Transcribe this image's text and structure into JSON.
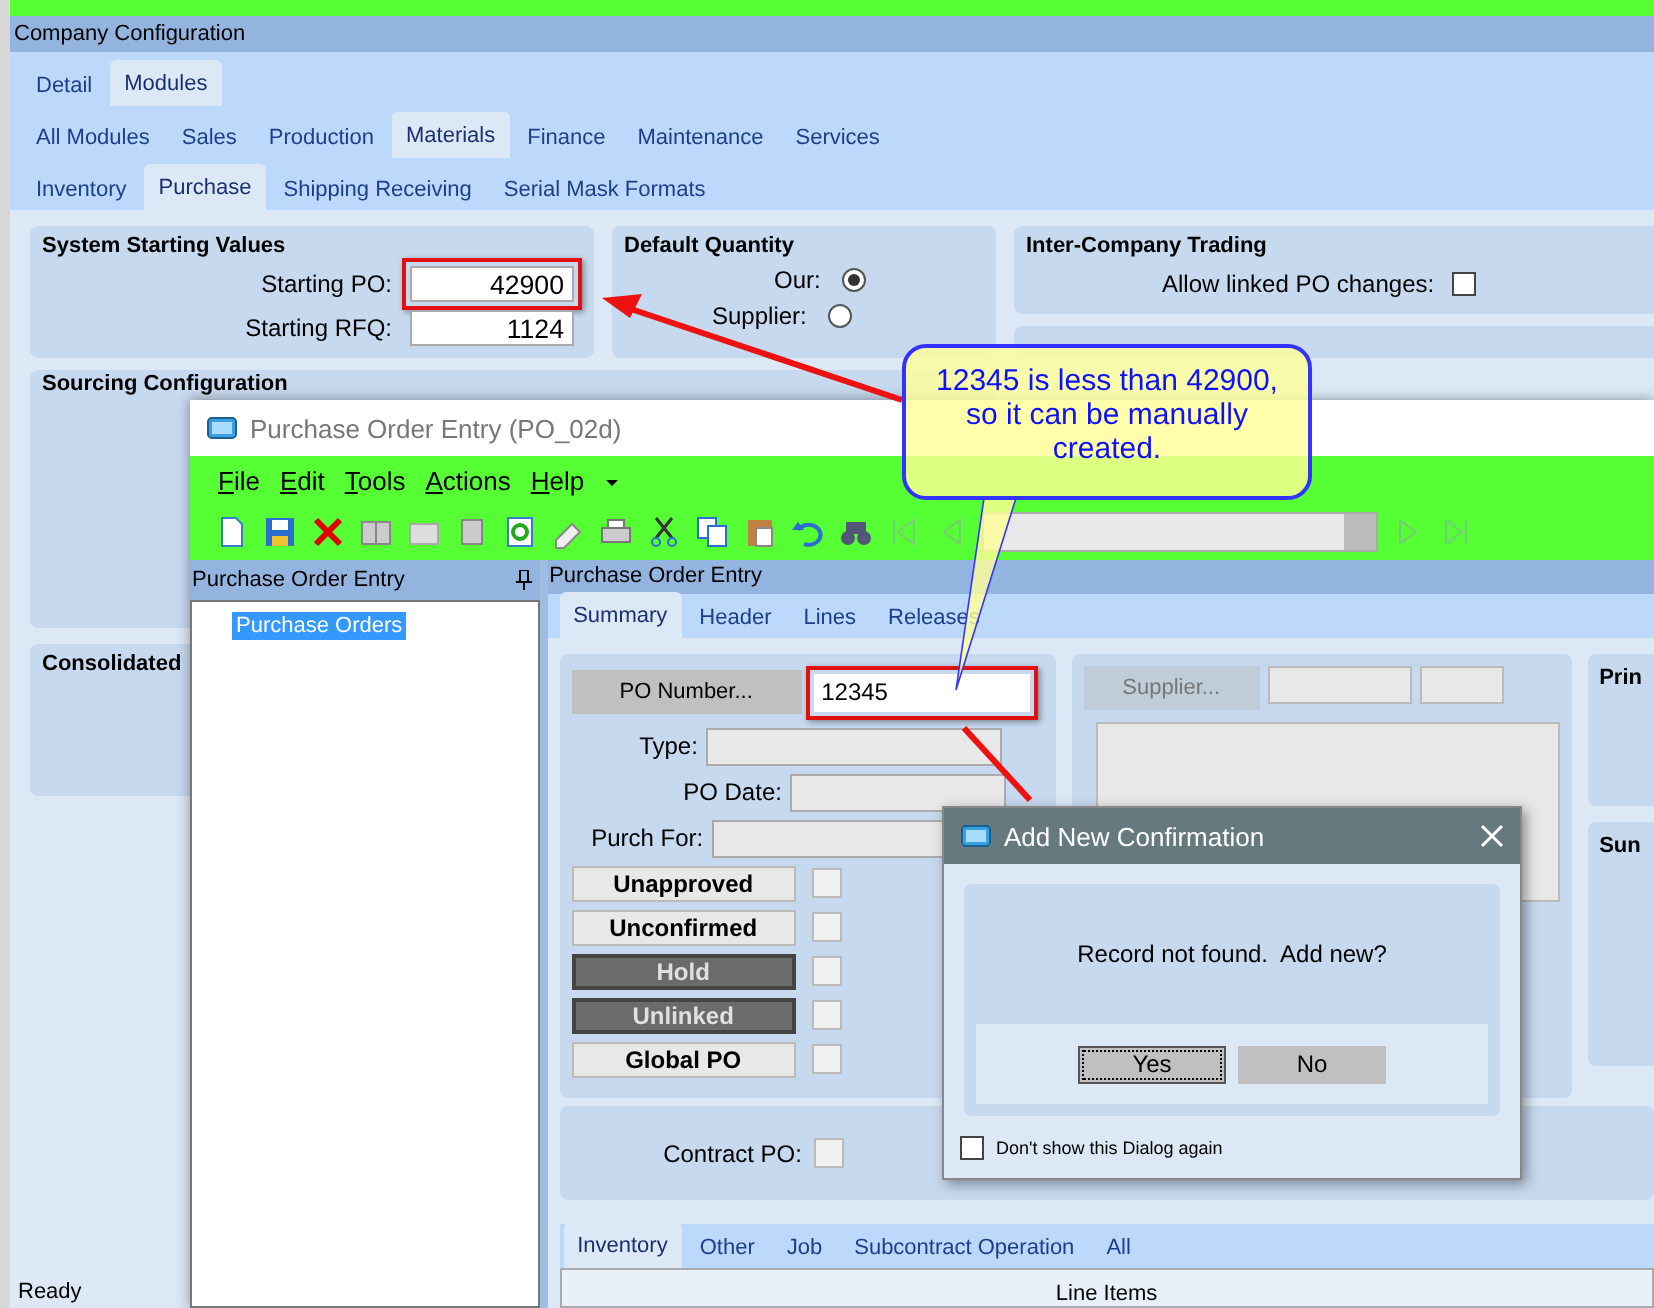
{
  "config_window": {
    "title": "Company Configuration",
    "tabs_1": [
      {
        "label": "Detail",
        "selected": false
      },
      {
        "label": "Modules",
        "selected": true
      }
    ],
    "tabs_2": [
      {
        "label": "All Modules",
        "selected": false
      },
      {
        "label": "Sales",
        "selected": false
      },
      {
        "label": "Production",
        "selected": false
      },
      {
        "label": "Materials",
        "selected": true
      },
      {
        "label": "Finance",
        "selected": false
      },
      {
        "label": "Maintenance",
        "selected": false
      },
      {
        "label": "Services",
        "selected": false
      }
    ],
    "tabs_3": [
      {
        "label": "Inventory",
        "selected": false
      },
      {
        "label": "Purchase",
        "selected": true
      },
      {
        "label": "Shipping Receiving",
        "selected": false
      },
      {
        "label": "Serial Mask Formats",
        "selected": false
      }
    ],
    "system_starting_values": {
      "title": "System Starting Values",
      "fields": [
        {
          "label": "Starting PO:",
          "value": "42900",
          "highlighted": true
        },
        {
          "label": "Starting RFQ:",
          "value": "1124",
          "highlighted": false
        }
      ]
    },
    "default_quantity": {
      "title": "Default Quantity",
      "options": [
        {
          "label": "Our:",
          "selected": true
        },
        {
          "label": "Supplier:",
          "selected": false
        }
      ]
    },
    "inter_company_trading": {
      "title": "Inter-Company Trading",
      "checkbox": {
        "label": "Allow linked PO changes:",
        "checked": false
      }
    },
    "sourcing_title": "Sourcing Configuration",
    "consolidated_title": "Consolidated",
    "status": "Ready"
  },
  "po_window": {
    "title": "Purchase Order Entry (PO_02d)",
    "menu": [
      "File",
      "Edit",
      "Tools",
      "Actions",
      "Help"
    ],
    "tree": {
      "header": "Purchase Order Entry",
      "items": [
        {
          "label": "Purchase Orders",
          "selected": true
        }
      ]
    },
    "detail_header": "Purchase Order Entry",
    "tabs": [
      {
        "label": "Summary",
        "selected": true
      },
      {
        "label": "Header",
        "selected": false
      },
      {
        "label": "Lines",
        "selected": false
      },
      {
        "label": "Releases",
        "selected": false
      }
    ],
    "po_number": {
      "button": "PO Number...",
      "value": "12345",
      "highlighted": true
    },
    "type_label": "Type:",
    "po_date_label": "PO Date:",
    "purch_for_label": "Purch For:",
    "status_buttons": [
      {
        "label": "Unapproved",
        "active": false,
        "checked": false
      },
      {
        "label": "Unconfirmed",
        "active": false,
        "checked": false
      },
      {
        "label": "Hold",
        "active": true,
        "checked": false
      },
      {
        "label": "Unlinked",
        "active": true,
        "checked": false
      },
      {
        "label": "Global PO",
        "active": false,
        "checked": false
      }
    ],
    "supplier_button": "Supplier...",
    "contract_po": {
      "label": "Contract PO:",
      "checked": false
    },
    "side_titles": [
      "Prin",
      "Sun"
    ],
    "bottom_tabs": [
      {
        "label": "Inventory",
        "selected": true
      },
      {
        "label": "Other",
        "selected": false
      },
      {
        "label": "Job",
        "selected": false
      },
      {
        "label": "Subcontract Operation",
        "selected": false
      },
      {
        "label": "All",
        "selected": false
      }
    ],
    "line_items": "Line Items"
  },
  "dialog": {
    "title": "Add New Confirmation",
    "message": "Record not found.  Add new?",
    "buttons": [
      {
        "label": "Yes",
        "selected": true
      },
      {
        "label": "No",
        "selected": false
      }
    ],
    "dont_show": {
      "label": "Don't show this Dialog again",
      "checked": false
    }
  },
  "callout": {
    "text": "12345 is less than 42900, so it can be manually created."
  }
}
